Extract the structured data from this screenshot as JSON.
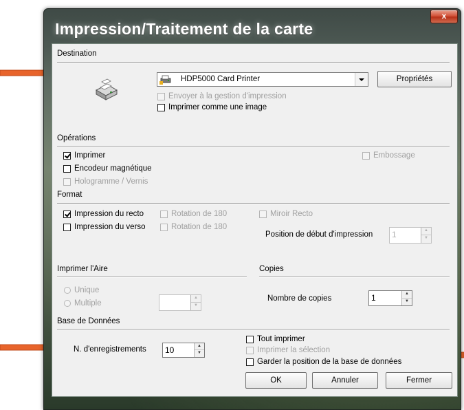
{
  "window": {
    "title": "Impression/Traitement de la carte",
    "close_glyph": "x"
  },
  "destination": {
    "label": "Destination",
    "printer_name": "HDP5000 Card Printer",
    "properties_button": "Propriétés",
    "send_to_spooler": "Envoyer à la gestion d'impression",
    "print_as_image": "Imprimer comme une image"
  },
  "operations": {
    "label": "Opérations",
    "print": "Imprimer",
    "magnetic_encoder": "Encodeur magnétique",
    "hologram": "Hologramme / Vernis",
    "embossing": "Embossage"
  },
  "format": {
    "label": "Format",
    "front": "Impression du recto",
    "back": "Impression du verso",
    "rotate_front": "Rotation de 180",
    "rotate_back": "Rotation de 180",
    "mirror_front": "Miroir Recto",
    "start_position_label": "Position de début d'impression",
    "start_position_value": "1"
  },
  "print_area": {
    "label": "Imprimer l'Aire",
    "single": "Unique",
    "multiple": "Multiple",
    "multiple_value": ""
  },
  "copies": {
    "label": "Copies",
    "count_label": "Nombre de copies",
    "count_value": "1"
  },
  "database": {
    "label": "Base de Données",
    "records_label": "N. d'enregistrements",
    "records_value": "10",
    "print_all": "Tout imprimer",
    "print_selection": "Imprimer la sélection",
    "keep_position": "Garder la position de la base de données"
  },
  "buttons": {
    "ok": "OK",
    "cancel": "Annuler",
    "close": "Fermer"
  },
  "colors": {
    "annotation_arrow": "#e8642b",
    "close_button": "#c94a30"
  }
}
